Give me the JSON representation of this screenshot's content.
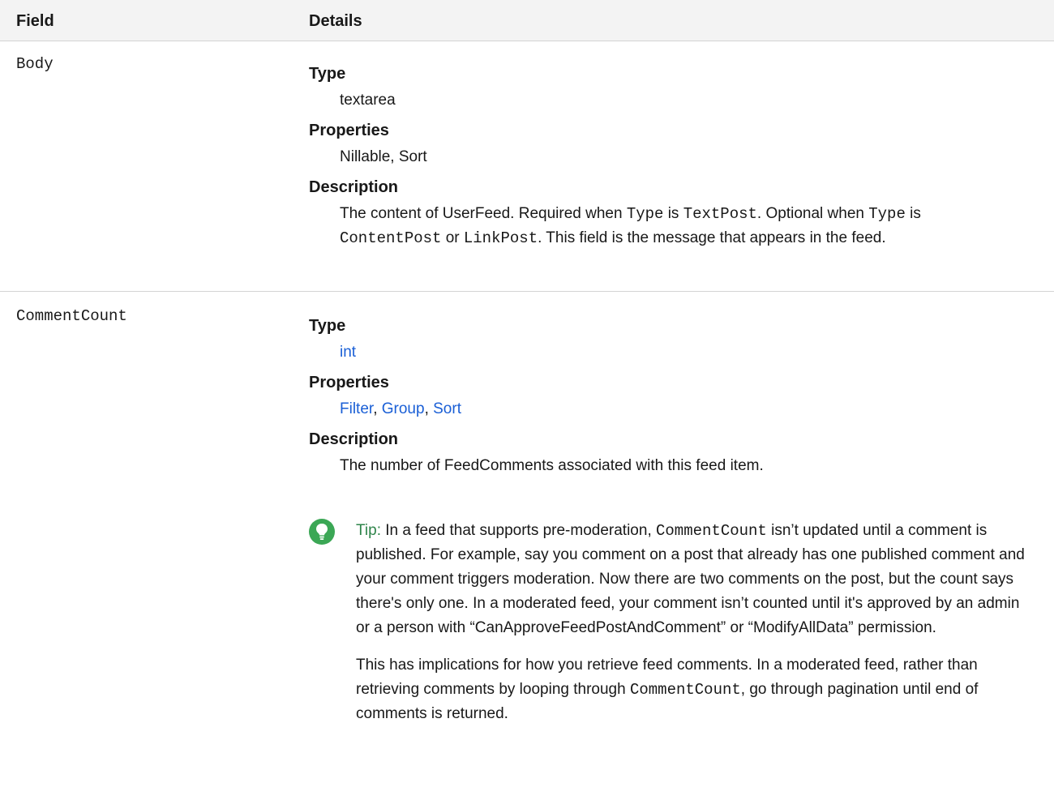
{
  "table": {
    "headers": {
      "field": "Field",
      "details": "Details"
    },
    "rows": [
      {
        "field": "Body",
        "type_label": "Type",
        "type_value": "textarea",
        "properties_label": "Properties",
        "properties_value": "Nillable, Sort",
        "description_label": "Description",
        "description": {
          "t1": "The content of UserFeed. Required when ",
          "c1": "Type",
          "t2": " is ",
          "c2": "TextPost",
          "t3": ". Optional when ",
          "c3": "Type",
          "t4": " is",
          "c4": "ContentPost",
          "t5": " or ",
          "c5": "LinkPost",
          "t6": ". This field is the message that appears in the feed."
        }
      },
      {
        "field": "CommentCount",
        "type_label": "Type",
        "type_value": "int",
        "properties_label": "Properties",
        "properties_links": [
          "Filter",
          "Group",
          "Sort"
        ],
        "properties_sep": ", ",
        "description_label": "Description",
        "description": "The number of FeedComments associated with this feed item.",
        "tip": {
          "label": "Tip:",
          "p1_a": " In a feed that supports pre-moderation, ",
          "p1_code": "CommentCount",
          "p1_b": " isn’t updated until a comment is published. For example, say you comment on a post that already has one published comment and your comment triggers moderation. Now there are two comments on the post, but the count says there's only one. In a moderated feed, your comment isn’t counted until it's approved by an admin or a person with “CanApproveFeedPostAndComment” or “ModifyAllData” permission.",
          "p2_a": "This has implications for how you retrieve feed comments. In a moderated feed, rather than retrieving comments by looping through ",
          "p2_code": "CommentCount",
          "p2_b": ", go through pagination until end of comments is returned."
        }
      }
    ]
  },
  "colors": {
    "link": "#1a5fd6",
    "tip_icon": "#3ba755",
    "tip_label": "#2e844a",
    "header_bg": "#f3f3f3"
  },
  "icons": {
    "tip": "lightbulb-icon"
  }
}
